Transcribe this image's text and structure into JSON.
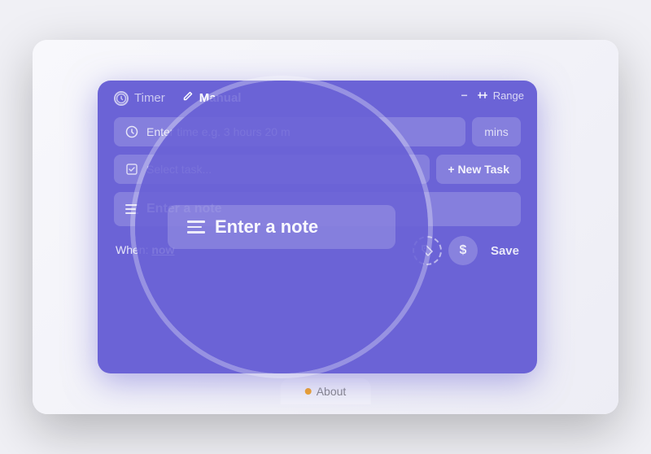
{
  "screen": {
    "background": "#ededf5"
  },
  "panel": {
    "background_color": "#6b63d6",
    "tabs": [
      {
        "id": "timer",
        "label": "Timer",
        "icon": "timer-circle",
        "active": false
      },
      {
        "id": "manual",
        "label": "Manual",
        "icon": "edit-icon",
        "active": true
      }
    ],
    "minimize_btn": "−",
    "range_label": "Range",
    "time_input": {
      "placeholder": "Enter time e.g. 3 hours 20 m",
      "mins_label": "mins"
    },
    "task_input": {
      "placeholder": "Select task..."
    },
    "new_task_btn": "+ New Task",
    "note_input": {
      "placeholder": "Enter a note"
    },
    "when_label": "When:",
    "when_value": "now",
    "tag_icon": "🏷",
    "dollar_icon": "$",
    "save_btn": "Save"
  },
  "about_tab": {
    "label": "About",
    "dot_color": "#f5a623"
  },
  "magnifier": {
    "lines_label": "≡",
    "note_text": "Enter a note"
  }
}
